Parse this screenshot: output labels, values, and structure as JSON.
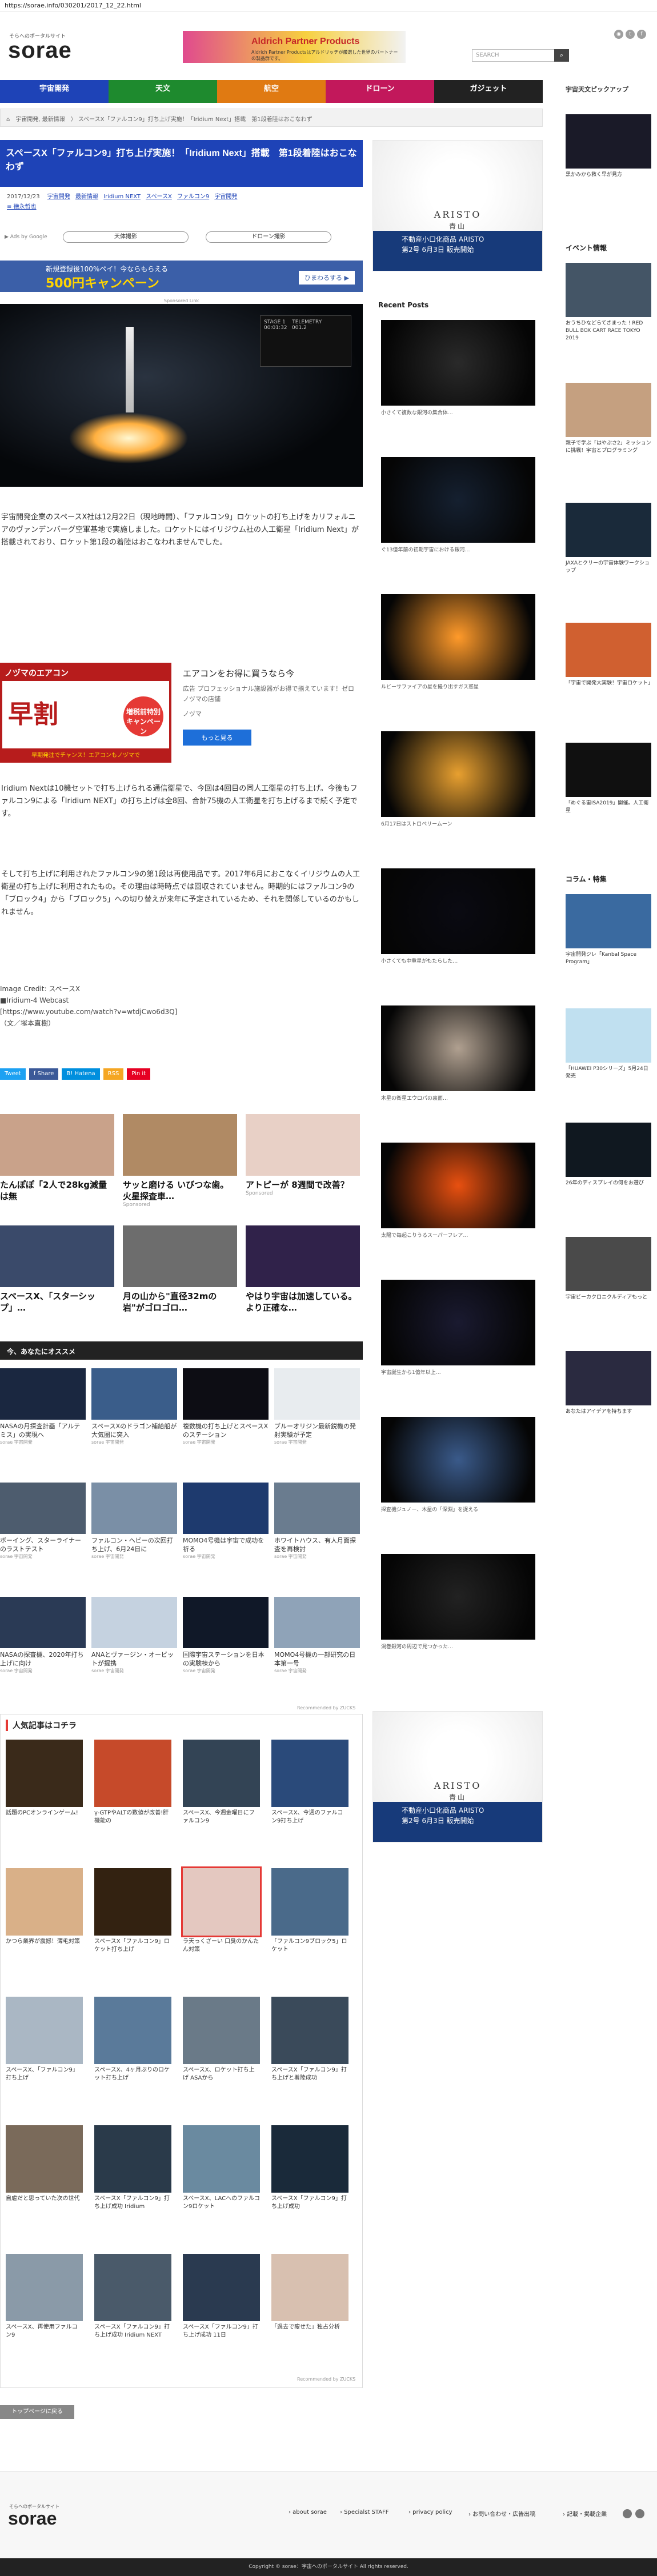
{
  "url": "https://sorae.info/030201/2017_12_22.html",
  "header": {
    "logo": "sorae",
    "tagline": "そらへのポータルサイト",
    "ad_title": "Aldrich Partner Products",
    "ad_sub": "Aldrich Partner Productsはアルドリッチが厳選した世界のパートナーの製品群です。",
    "search_placeholder": "SEARCH",
    "search_icon": "search-icon"
  },
  "nav": [
    {
      "label": "宇宙開発",
      "color": "#1e43b7"
    },
    {
      "label": "天文",
      "color": "#1e8a2e"
    },
    {
      "label": "航空",
      "color": "#e07a12"
    },
    {
      "label": "ドローン",
      "color": "#c2185b"
    },
    {
      "label": "ガジェット",
      "color": "#222222"
    }
  ],
  "breadcrumb": "⌂　宇宙開発, 最新情報　〉 スペースX「ファルコン9」打ち上げ実施！「Iridium Next」搭載　第1段着陸はおこなわず",
  "article": {
    "title": "スペースX「ファルコン9」打ち上げ実施！「Iridium Next」搭載　第1段着陸はおこなわず",
    "date": "2017/12/23",
    "tags": [
      "宇宙開発",
      "最新情報",
      "Iridium NEXT",
      "スペースX",
      "ファルコン9",
      "宇宙開発"
    ],
    "author": "≡ 徳永哲也",
    "adsby": "▶ Ads by Google",
    "pill1": "天体撮影",
    "pill2": "ドローン撮影",
    "banner": {
      "a": "新規登録後100%ペイ！今ならもらえる",
      "b": "500円キャンペーン",
      "c": "ひまわるする ▶"
    },
    "sponsored": "Sponsored Link",
    "hero_cam": "STAGE 1    TELEMETRY\n00:01:32   001.2",
    "p1": "宇宙開発企業のスペースX社は12月22日（現地時間）、「ファルコン9」ロケットの打ち上げをカリフォルニアのヴァンデンバーグ空軍基地で実施しました。ロケットにはイリジウム社の人工衛星「Iridium Next」が搭載されており、ロケット第1段の着陸はおこなわれませんでした。",
    "ad2": {
      "head": "ノヅマのエアコン",
      "big": "早割",
      "badge": "増税前特別キャンペーン",
      "foot": "早期発注でチャンス！エアコンもノヅマで",
      "title": "エアコンをお得に買うなら今",
      "sub": "広告 プロフェッショナル施設器がお得で揃えています！ゼロノヅマの店舗",
      "brand": "ノヅマ",
      "btn": "もっと見る"
    },
    "p2": "Iridium Nextは10機セットで打ち上げられる通信衛星で、今回は4回目の同人工衛星の打ち上げ。今後もファルコン9による「Iridium NEXT」の打ち上げは全8回、合計75機の人工衛星を打ち上げるまで続く予定です。",
    "p3": "そして打ち上げに利用されたファルコン9の第1段は再使用品です。2017年6月におこなくイリジウムの人工衛星の打ち上げに利用されたもの。その理由は時時点では回収されていません。時期的にはファルコン9の「ブロック4」から「ブロック5」への切り替えが来年に予定されているため、それを関係しているのかもしれません。",
    "source": "Image Credit: スペースX\n■Iridium-4 Webcast\n[https://www.youtube.com/watch?v=wtdjCwo6d3Q]\n（文／塚本直樹）",
    "share": [
      {
        "label": "Tweet",
        "color": "#1da1f2"
      },
      {
        "label": "f Share",
        "color": "#3b5998"
      },
      {
        "label": "B! Hatena",
        "color": "#008fde"
      },
      {
        "label": "RSS",
        "color": "#f5a623"
      },
      {
        "label": "Pin it",
        "color": "#e60023"
      }
    ]
  },
  "related": [
    {
      "t": "たんぽぽ「2人で28kg減量は無",
      "s": "",
      "c": "#c9a28a"
    },
    {
      "t": "サッと磨ける いびつな歯。火星探査車…",
      "s": "Sponsored",
      "c": "#b08a64"
    },
    {
      "t": "アトピーが 8週間で改善？",
      "s": "Sponsored",
      "c": "#e8d0c6"
    },
    {
      "t": "スペースX、「スターシップ」…",
      "s": "",
      "c": "#3a4a6a"
    },
    {
      "t": "月の山から\"直径32mの岩\"がゴロゴロ…",
      "s": "",
      "c": "#6d6d6d"
    },
    {
      "t": "やはり宇宙は加速している。より正確な…",
      "s": "",
      "c": "#30224a"
    }
  ],
  "reco_title": "今、あなたにオススメ",
  "reco": [
    {
      "t": "NASAの月探査計画「アルテミス」の実現へ",
      "s": "sorae 宇宙開発",
      "c": "#1a2740"
    },
    {
      "t": "スペースXのドラゴン補給船が大気圏に突入",
      "s": "sorae 宇宙開発",
      "c": "#3a5d8a"
    },
    {
      "t": "複数機の打ち上げとスペースXのステーション",
      "s": "sorae 宇宙開発",
      "c": "#0d0d14"
    },
    {
      "t": "ブルーオリジン最新鋭機の発射実験が予定",
      "s": "sorae 宇宙開発",
      "c": "#e8ecef"
    },
    {
      "t": "ボーイング、スターライナーのラストテスト",
      "s": "sorae 宇宙開発",
      "c": "#4d5c6e"
    },
    {
      "t": "ファルコン・ヘビーの次回打ち上げ、6月24日に",
      "s": "sorae 宇宙開発",
      "c": "#7a8fa6"
    },
    {
      "t": "MOMO4号機は宇宙で成功を祈る",
      "s": "sorae 宇宙開発",
      "c": "#1e3a6e"
    },
    {
      "t": "ホワイトハウス、有人月面探査を再検討",
      "s": "sorae 宇宙開発",
      "c": "#6a7c8f"
    },
    {
      "t": "NASAの探査機、2020年打ち上げに向け",
      "s": "sorae 宇宙開発",
      "c": "#2a3a55"
    },
    {
      "t": "ANAとヴァージン・オービットが提携",
      "s": "sorae 宇宙開発",
      "c": "#c5d2e0"
    },
    {
      "t": "国際宇宙ステーションを日本の実験棟から",
      "s": "sorae 宇宙開発",
      "c": "#101828"
    },
    {
      "t": "MOMO4号機の一部研究の日本第一号",
      "s": "sorae 宇宙開発",
      "c": "#8fa3b8"
    }
  ],
  "reco_footer": "Recommended by ZUCKS",
  "popular_title": "人気記事はコチラ",
  "popular": [
    {
      "t": "話題のPCオンラインゲーム!",
      "c": "#3a2a1a"
    },
    {
      "t": "γ-GTPやALTの数値が改善!肝機能の",
      "c": "#c64a2a"
    },
    {
      "t": "スペースX、今週金曜日にファルコン9",
      "c": "#334455"
    },
    {
      "t": "スペースX、今週のファルコン9打ち上げ",
      "c": "#2a4a7a"
    },
    {
      "t": "かつら業界が震撼！薄毛対策",
      "c": "#d9b088"
    },
    {
      "t": "スペースX「ファルコン9」ロケット打ち上げ",
      "c": "#332211"
    },
    {
      "t": "ラ天っくざーい 口臭のかんたん対策",
      "c": "#e4c8c0"
    },
    {
      "t": "「ファルコン9ブロック5」ロケット",
      "c": "#4a6a8a"
    },
    {
      "t": "スペースX、「ファルコン9」打ち上げ",
      "c": "#aab7c4"
    },
    {
      "t": "スペースX、4ヶ月ぶりのロケット打ち上げ",
      "c": "#5a7a9a"
    },
    {
      "t": "スペースX、ロケット打ち上げ ASAから",
      "c": "#6a7a88"
    },
    {
      "t": "スペースX「ファルコン9」打ち上げと着陸成功",
      "c": "#3a4a5a"
    },
    {
      "t": "自虐だと思っていた次の世代",
      "c": "#7a6a5a"
    },
    {
      "t": "スペースX「ファルコン9」打ち上げ成功 Iridium",
      "c": "#2a3a4a"
    },
    {
      "t": "スペースX、LACへのファルコン9ロケット",
      "c": "#6a8aa0"
    },
    {
      "t": "スペースX「ファルコン9」打ち上げ成功",
      "c": "#1a2a3a"
    },
    {
      "t": "スペースX、再使用ファルコン9",
      "c": "#8a9aa8"
    },
    {
      "t": "スペースX「ファルコン9」打ち上げ成功 Iridium NEXT",
      "c": "#4a5a6a"
    },
    {
      "t": "スペースX「ファルコン9」打ち上げ成功 11日",
      "c": "#2a3a50"
    },
    {
      "t": "「過去で痩せた」独占分析",
      "c": "#d8c0b0"
    }
  ],
  "popular_footer": "Recommended by ZUCKS",
  "toplink": "トップページに戻る",
  "sidebar": {
    "pickup_title": "宇宙天文ピックアップ",
    "pickup_text": "黒かみから救く早が見方",
    "ad_name": "ARISTO",
    "ad_sub": "青山",
    "ad_bar": "不動産小口化商品 ARISTO\n第2号 6月3日 販売開始",
    "recent_title": "Recent Posts",
    "recent": [
      {
        "t": "小さくて複数な銀河の集合体…",
        "c": "#2a2a2a"
      },
      {
        "t": "ぐ13億年前の初期宇宙における銀河…",
        "c": "#152030"
      },
      {
        "t": "ルビーサファイアの星を撮り出すガス惑星",
        "c": "#ff9a2a"
      },
      {
        "t": "6月17日はストロベリームーン",
        "c": "#e8a030"
      },
      {
        "t": "小さくても中重星がもたらした…",
        "c": "#0a0a12"
      },
      {
        "t": "木星の衛星エウロパの裏面…",
        "c": "#b0a090"
      },
      {
        "t": "太陽で毎起こりうるスーパーフレア…",
        "c": "#e85010"
      },
      {
        "t": "宇宙誕生から1億年以上…",
        "c": "#1a1a30"
      },
      {
        "t": "探査機ジュノー、木星の「深淵」を捉える",
        "c": "#3a5a8a"
      },
      {
        "t": "渦巻銀河の周辺で見つかった…",
        "c": "#222"
      }
    ],
    "event_title": "イベント情報",
    "events": [
      {
        "t": "おうちひなどらてきまった ! RED BULL BOX CART RACE TOKYO 2019",
        "c": "#445566"
      },
      {
        "t": "親子で学ぶ「はやぶさ2」ミッションに挑戦！宇宙とプログラミング",
        "c": "#c5a080"
      },
      {
        "t": "JAXAとクリーの宇宙体験ワークショップ",
        "c": "#1a2a3a"
      },
      {
        "t": "「宇宙で開発大実験！宇宙ロケット」",
        "c": "#d06030"
      },
      {
        "t": "「めぐる宙ISA2019」開催。人工衛星",
        "c": "#101010"
      }
    ],
    "column_title": "コラム・特集",
    "columns": [
      {
        "t": "宇宙開発ジレ「Kanbal Space Program」",
        "c": "#3a6aa0"
      },
      {
        "t": "「HUAWEI P30シリーズ」5月24日発売",
        "c": "#c0e0f0"
      },
      {
        "t": "26年のディスプレイの何をお選び",
        "c": "#101820"
      },
      {
        "t": "宇宙ビーカクロニクルディアもっと",
        "c": "#4a4a4a"
      },
      {
        "t": "あなたはアイデアを持ちます",
        "c": "#2a2a40"
      }
    ]
  },
  "footer": {
    "logo": "sorae",
    "tagline": "そらへのポータルサイト",
    "links": [
      "› about sorae",
      "› Specialst STAFF",
      "› privacy policy",
      "› お問い合わせ・広告出稿",
      "› 記載・掲載企業"
    ],
    "copyright": "Copyright © sorae：宇宙へのポータルサイト All rights reserved."
  }
}
